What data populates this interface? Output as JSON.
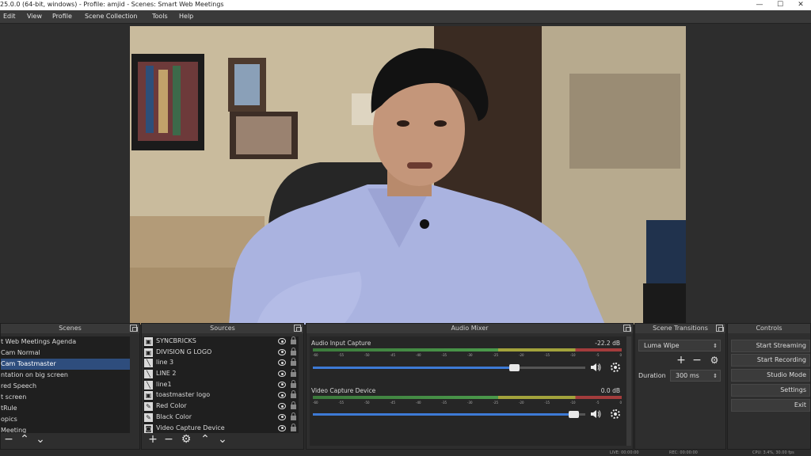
{
  "window": {
    "title": "25.0.0 (64-bit, windows) - Profile: amjid - Scenes: Smart Web Meetings",
    "minimize": "—",
    "maximize": "☐",
    "close": "✕"
  },
  "menu": [
    "Edit",
    "View",
    "Profile",
    "Scene Collection",
    "Tools",
    "Help"
  ],
  "scenes": {
    "title": "Scenes",
    "items": [
      "t Web Meetings Agenda",
      "Cam Normal",
      "Cam Toastmaster",
      "ntation on big screen",
      "red Speech",
      "t screen",
      "tRule",
      "opics",
      "Meeting"
    ],
    "active_index": 2
  },
  "sources": {
    "title": "Sources",
    "items": [
      {
        "name": "SYNCBRICKS",
        "icon": "image-icon"
      },
      {
        "name": "DIVISION G LOGO",
        "icon": "image-icon"
      },
      {
        "name": "line 3",
        "icon": "line-icon"
      },
      {
        "name": "LINE 2",
        "icon": "line-icon"
      },
      {
        "name": "line1",
        "icon": "line-icon"
      },
      {
        "name": "toastmaster logo",
        "icon": "image-icon"
      },
      {
        "name": "Red Color",
        "icon": "brush-icon"
      },
      {
        "name": "Black Color",
        "icon": "brush-icon"
      },
      {
        "name": "Video Capture Device",
        "icon": "camera-icon"
      }
    ]
  },
  "mixer": {
    "title": "Audio Mixer",
    "channels": [
      {
        "name": "Audio Input Capture",
        "db": "-22.2 dB",
        "level": 0.74
      },
      {
        "name": "Video Capture Device",
        "db": "0.0 dB",
        "level": 0.96
      }
    ],
    "scale": [
      "-60",
      "-55",
      "-50",
      "-45",
      "-40",
      "-35",
      "-30",
      "-25",
      "-20",
      "-15",
      "-10",
      "-5",
      "0"
    ]
  },
  "transitions": {
    "title": "Scene Transitions",
    "selected": "Luma Wipe",
    "duration_label": "Duration",
    "duration_value": "300 ms"
  },
  "controls": {
    "title": "Controls",
    "buttons": [
      "Start Streaming",
      "Start Recording",
      "Studio Mode",
      "Settings",
      "Exit"
    ]
  },
  "status": {
    "live": "LIVE: 00:00:00",
    "rec": "REC: 00:00:00",
    "cpu": "CPU: 3.4%, 30.00 fps"
  }
}
